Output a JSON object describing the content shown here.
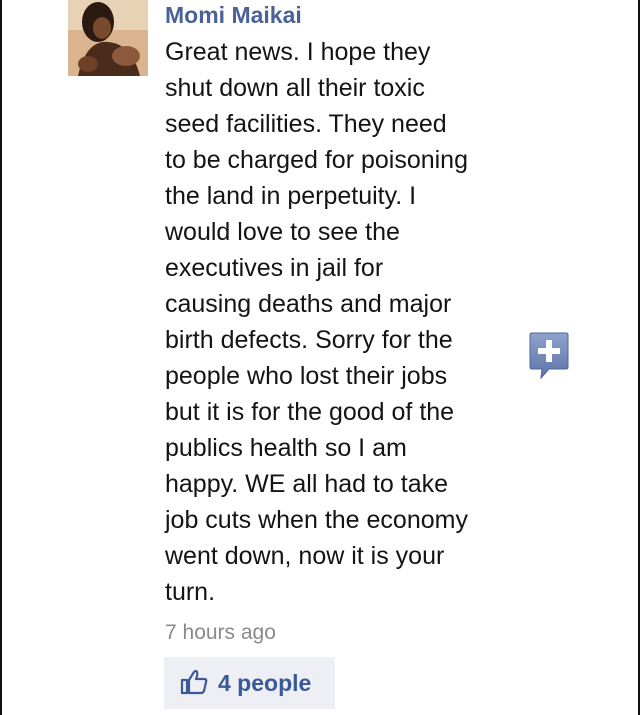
{
  "comment": {
    "author": "Momi Maikai",
    "lines": [
      "Great news. I hope they",
      "shut down all their toxic",
      "seed facilities. They need",
      "to be charged for poisoning",
      "the land in perpetuity. I",
      "would love to see the",
      "executives in jail for",
      "causing deaths and major",
      "birth defects. Sorry for the",
      "people who lost their jobs",
      "but it is for the good of the",
      "publics health so I am",
      "happy. WE all had to take",
      "job cuts when the economy",
      "went down, now it is your",
      "turn."
    ],
    "timestamp": "7 hours ago",
    "likes_label": "4 people"
  },
  "icons": {
    "add_reply": "plus-speech-bubble-icon",
    "like": "thumbs-up-icon"
  },
  "colors": {
    "author_link": "#4b6199",
    "like_text": "#3b5998",
    "like_background": "#edeff4",
    "bubble_blue": "#6b84b8",
    "timestamp": "#8a8a8a"
  }
}
